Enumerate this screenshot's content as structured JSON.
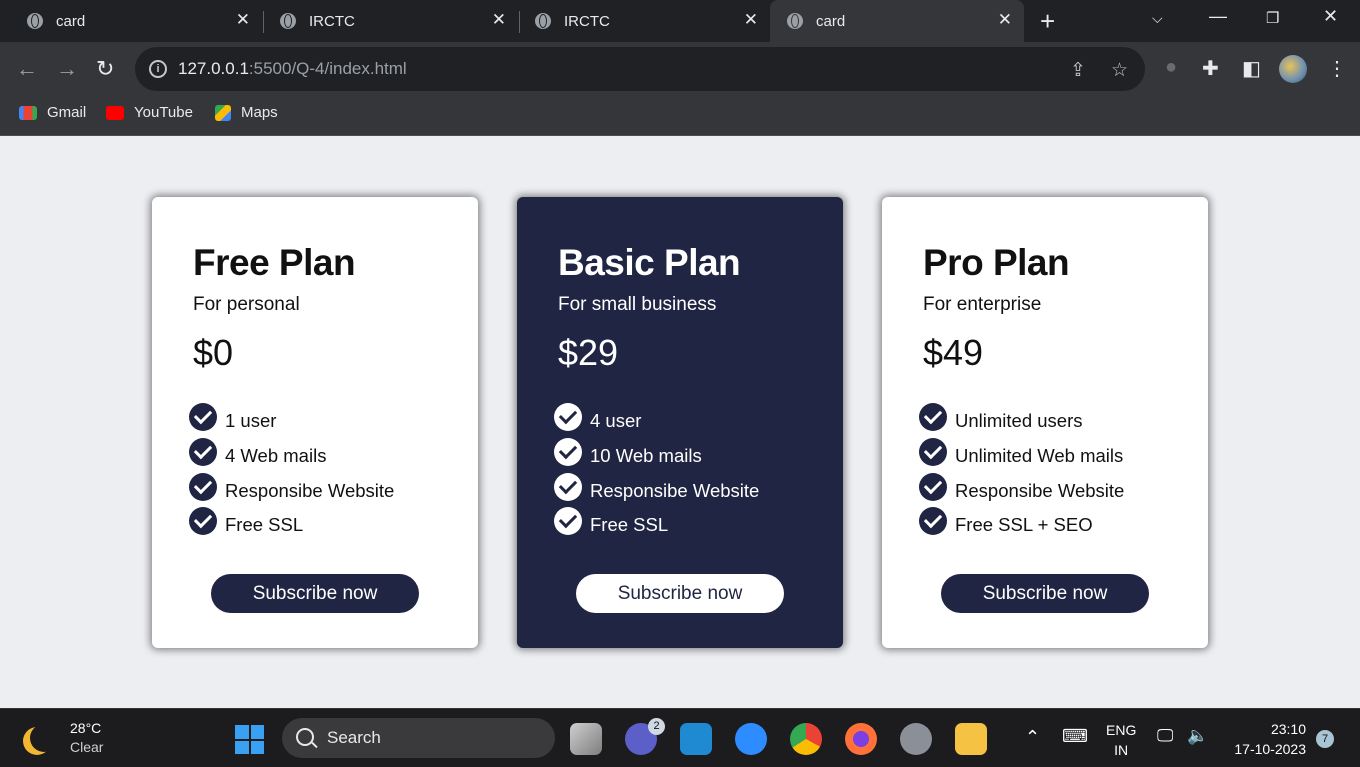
{
  "browser": {
    "tabs": [
      {
        "title": "card",
        "active": false
      },
      {
        "title": "IRCTC",
        "active": false
      },
      {
        "title": "IRCTC",
        "active": false
      },
      {
        "title": "card",
        "active": true
      }
    ],
    "url_host": "127.0.0.1",
    "url_rest": ":5500/Q-4/index.html",
    "bookmarks": [
      {
        "label": "Gmail",
        "icon": "gmail-icon"
      },
      {
        "label": "YouTube",
        "icon": "youtube-icon"
      },
      {
        "label": "Maps",
        "icon": "maps-icon"
      }
    ]
  },
  "plans": [
    {
      "title": "Free Plan",
      "subtitle": "For personal",
      "price": "$0",
      "features": [
        "1 user",
        "4 Web mails",
        "Responsibe Website",
        "Free SSL"
      ],
      "button": "Subscribe now",
      "theme": "light"
    },
    {
      "title": "Basic Plan",
      "subtitle": "For small business",
      "price": "$29",
      "features": [
        "4 user",
        "10 Web mails",
        "Responsibe Website",
        "Free SSL"
      ],
      "button": "Subscribe now",
      "theme": "dark"
    },
    {
      "title": "Pro Plan",
      "subtitle": "For enterprise",
      "price": "$49",
      "features": [
        "Unlimited users",
        "Unlimited Web mails",
        "Responsibe Website",
        "Free SSL + SEO"
      ],
      "button": "Subscribe now",
      "theme": "light"
    }
  ],
  "colors": {
    "navy": "#1f2542",
    "page_bg": "#eceef2"
  },
  "taskbar": {
    "weather_temp": "28°C",
    "weather_cond": "Clear",
    "search_label": "Search",
    "teams_badge": "2",
    "lang": "ENG",
    "region": "IN",
    "time": "23:10",
    "date": "17-10-2023",
    "notifications": "7"
  }
}
